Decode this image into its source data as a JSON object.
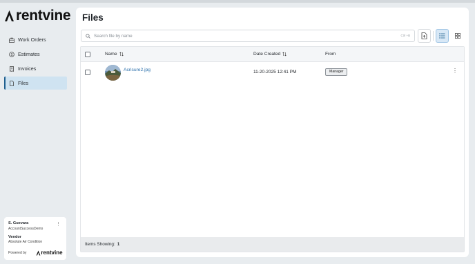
{
  "brand": {
    "name": "rentvine",
    "accent": "#1f5f8f"
  },
  "sidebar": {
    "items": [
      {
        "label": "Work Orders",
        "icon": "toolbox-icon",
        "active": false
      },
      {
        "label": "Estimates",
        "icon": "dollar-circle-icon",
        "active": false
      },
      {
        "label": "Invoices",
        "icon": "receipt-icon",
        "active": false
      },
      {
        "label": "Files",
        "icon": "file-icon",
        "active": true
      }
    ],
    "user": {
      "name": "S. Guevara",
      "org": "AccountSuccessDemo",
      "role": "Vendor",
      "company": "Absolute Air Condition",
      "powered_by": "Powered by",
      "powered_brand": "rentvine"
    }
  },
  "main": {
    "title": "Files",
    "search": {
      "placeholder": "Search file by name",
      "shortcut": "Ctrl +B"
    },
    "view_mode": "list",
    "table": {
      "columns": [
        "Name",
        "Date Created",
        "From"
      ],
      "rows": [
        {
          "name": "Acrisure2.jpg",
          "date_created": "11-20-2025 12:41 PM",
          "from": "Manager"
        }
      ],
      "footer_label": "Items Showing:",
      "items_showing": "1"
    }
  }
}
